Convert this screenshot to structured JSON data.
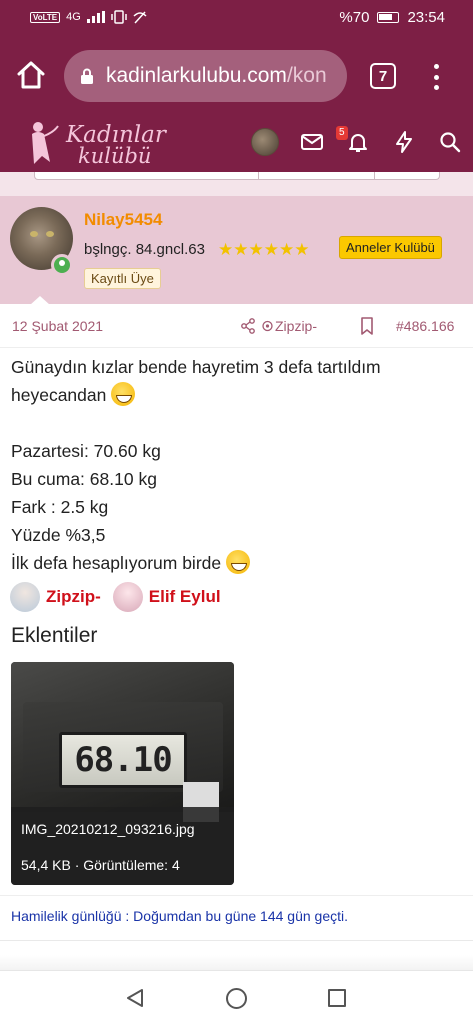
{
  "status_bar": {
    "network": "4G",
    "battery": "%70",
    "time": "23:54"
  },
  "browser": {
    "url_main": "kadinlarkulubu.com",
    "url_rest": "/kon",
    "tab_count": "7"
  },
  "site_header": {
    "logo_line1": "Kadınlar",
    "logo_line2": "kulübü",
    "notification_count": "5"
  },
  "post": {
    "user": {
      "name": "Nilay5454",
      "title": "bşlngç. 84.gncl.63",
      "stars": "★★★★★★",
      "group": "Anneler Kulübü",
      "role": "Kayıtlı Üye"
    },
    "date": "12 Şubat 2021",
    "quote_name": "Zipzip-",
    "post_number": "#486.166",
    "body": {
      "line1": "Günaydın kızlar bende hayretim 3 defa tartıldım heyecandan",
      "line2": "Pazartesi: 70.60 kg",
      "line3": "Bu cuma: 68.10 kg",
      "line4": "Fark : 2.5 kg",
      "line5": "Yüzde %3,5",
      "line6": "İlk defa hesaplıyorum birde"
    },
    "likes": [
      "Zipzip-",
      "Elif Eylul"
    ],
    "attachments_title": "Eklentiler",
    "attachment": {
      "display": "68.10",
      "file_name": "IMG_20210212_093216.jpg",
      "meta": "54,4 KB · Görüntüleme: 4"
    },
    "signature": "Hamilelik günlüğü : Doğumdan bu güne 144 gün geçti."
  }
}
